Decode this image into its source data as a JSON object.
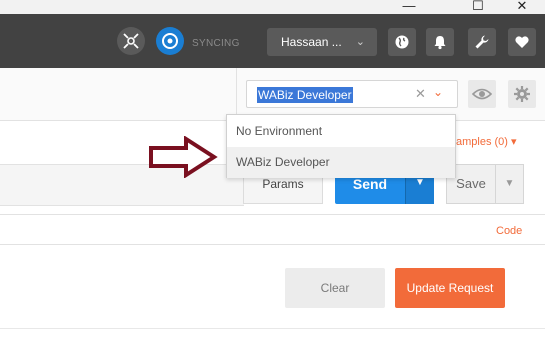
{
  "titlebar": {
    "minimize": "—",
    "maximize": "☐",
    "close": "✕"
  },
  "header": {
    "sync_label": "SYNCING",
    "user_name": "Hassaan ...",
    "icons": [
      "interceptor-icon",
      "sync-icon",
      "globe-icon",
      "bell-icon",
      "wrench-icon",
      "heart-icon"
    ]
  },
  "environment": {
    "selected": "WABiz Developer",
    "options": [
      "No Environment",
      "WABiz Developer"
    ],
    "highlighted_index": 1
  },
  "request": {
    "examples_label": "amples (0) ▾",
    "params_label": "Params",
    "send_label": "Send",
    "save_label": "Save",
    "code_label": "Code"
  },
  "actions": {
    "clear_label": "Clear",
    "update_label": "Update Request"
  },
  "colors": {
    "header_bg": "#424242",
    "accent_orange": "#f26b3a",
    "send_blue": "#1f8ce8",
    "annotation_arrow": "#7a1020"
  }
}
